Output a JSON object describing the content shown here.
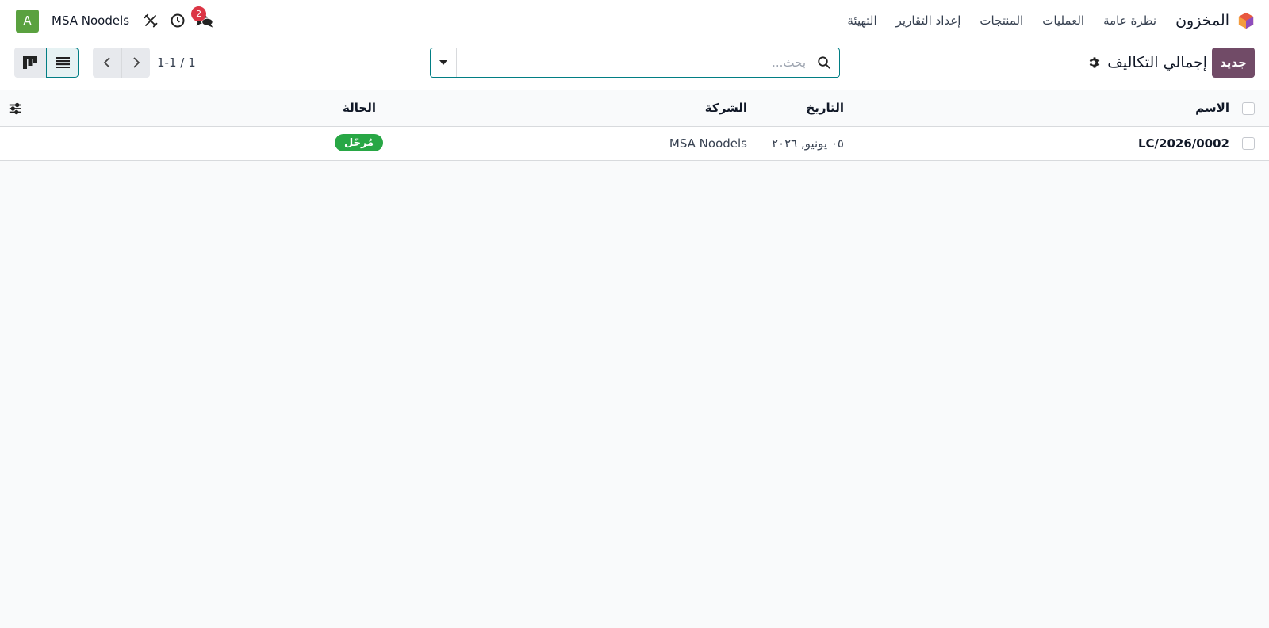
{
  "navbar": {
    "app_name": "المخزون",
    "menu": [
      "نظرة عامة",
      "العمليات",
      "المنتجات",
      "إعداد التقارير",
      "التهيئة"
    ],
    "company": "MSA Noodels",
    "avatar_letter": "A",
    "messages_count": "2",
    "icons": [
      "chat-icon",
      "clock-icon",
      "tools-icon"
    ]
  },
  "control_panel": {
    "new_label": "جديد",
    "title": "إجمالي التكاليف",
    "search_placeholder": "بحث...",
    "pager": "1-1 / 1"
  },
  "list": {
    "headers": {
      "name": "الاسم",
      "date": "التاريخ",
      "company": "الشركة",
      "status": "الحالة"
    },
    "rows": [
      {
        "name": "LC/2026/0002",
        "date": "٠٥ يونيو, ٢٠٢٦",
        "company": "MSA Noodels",
        "status": "مُرحّل"
      }
    ]
  },
  "colors": {
    "primary": "#714b67",
    "accent": "#017e84",
    "success": "#28a745",
    "badge": "#dc3545"
  }
}
